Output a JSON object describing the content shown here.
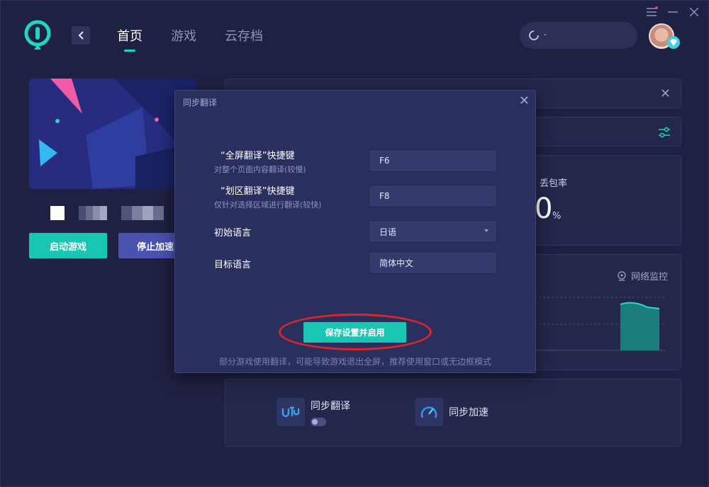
{
  "window": {
    "controls": [
      "menu-icon",
      "minimize-icon",
      "close-icon"
    ],
    "accent_color": "#19c6b4"
  },
  "header": {
    "nav": [
      {
        "label": "首页",
        "active": true
      },
      {
        "label": "游戏",
        "active": false
      },
      {
        "label": "云存档",
        "active": false
      }
    ],
    "search": {
      "value": "·"
    }
  },
  "left": {
    "start_button": "启动游戏",
    "stop_button": "停止加速"
  },
  "stats": {
    "packet_loss_label": "丢包率",
    "packet_loss_value": "0",
    "packet_loss_unit": "%"
  },
  "chart_panel": {
    "monitor_label": "网络监控"
  },
  "features": [
    {
      "label": "同步翻译",
      "icon": "translate-icon",
      "toggle_on": false
    },
    {
      "label": "同步加速",
      "icon": "speedometer-icon"
    }
  ],
  "modal": {
    "title": "同步翻译",
    "rows": [
      {
        "label": "“全屏翻译”快捷键",
        "sub": "对整个页面内容翻译(较慢)",
        "value": "F6"
      },
      {
        "label": "“划区翻译”快捷键",
        "sub": "仅针对选择区域进行翻译(较快)",
        "value": "F8"
      },
      {
        "label": "初始语言",
        "sub": "",
        "value": "日语"
      },
      {
        "label": "目标语言",
        "sub": "",
        "value": "简体中文"
      }
    ],
    "save_button": "保存设置并启用",
    "note": "部分游戏使用翻译，可能导致游戏退出全屏，推荐使用窗口或无边框模式"
  }
}
